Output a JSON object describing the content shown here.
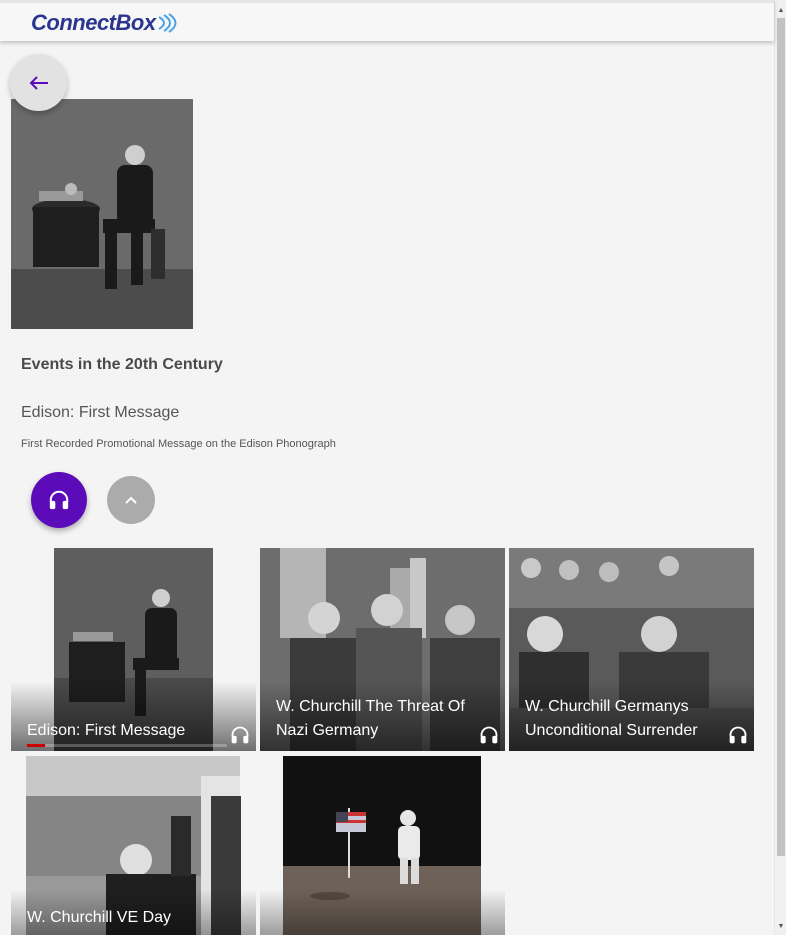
{
  "header": {
    "logo_text": "ConnectBox"
  },
  "hero": {
    "image_alt": "Edison seated beside the phonograph"
  },
  "section_title": "Events in the 20th Century",
  "item": {
    "title": "Edison: First Message",
    "description": "First Recorded Promotional Message on the Edison Phonograph"
  },
  "buttons": {
    "back_icon": "arrow-left-icon",
    "listen_icon": "headphones-icon",
    "collapse_icon": "chevron-up-icon"
  },
  "tiles": [
    {
      "label": "Edison: First Message",
      "icon": "headphones-icon",
      "progress": 0.09
    },
    {
      "label": "W. Churchill The Threat Of Nazi Germany",
      "icon": "headphones-icon"
    },
    {
      "label": "W. Churchill Germanys Unconditional Surrender",
      "icon": "headphones-icon"
    },
    {
      "label": "W. Churchill VE Day",
      "icon": "headphones-icon"
    },
    {
      "label": "",
      "icon": "headphones-icon"
    }
  ],
  "colors": {
    "accent": "#5c0bb8",
    "progress": "#cc0000",
    "logo": "#2b3590"
  }
}
